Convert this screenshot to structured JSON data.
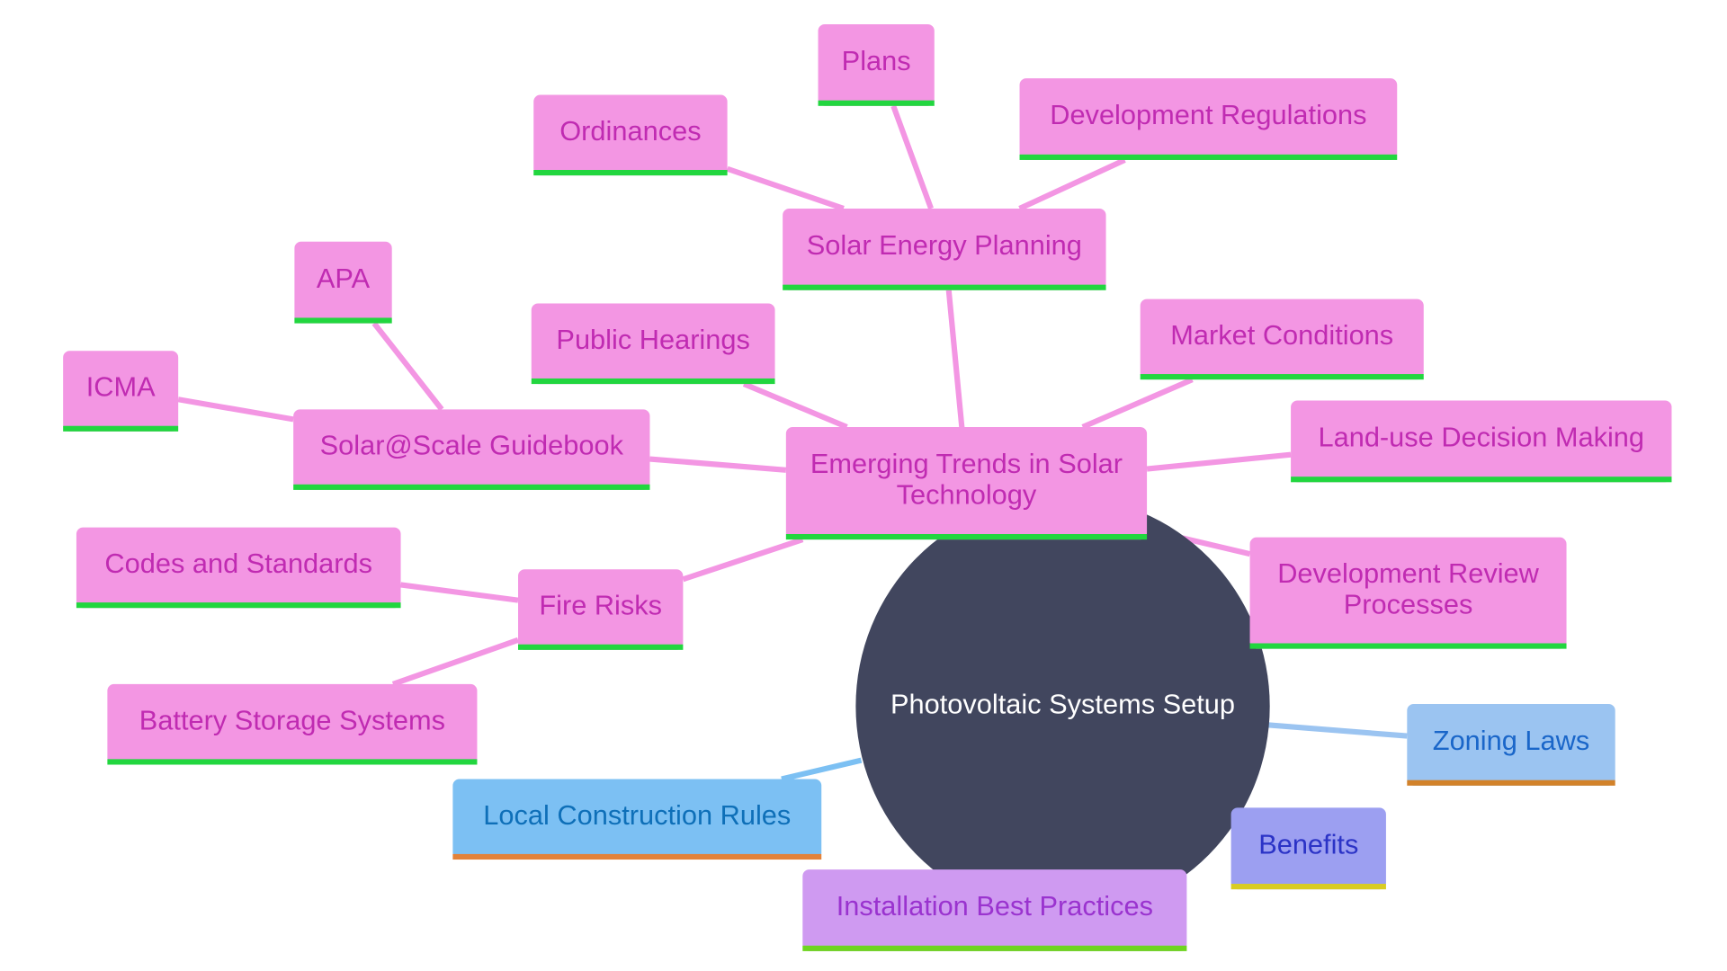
{
  "diagram": {
    "type": "mindmap",
    "root": {
      "label": "Photovoltaic Systems Setup"
    },
    "nodes": [
      {
        "id": "emerging",
        "label": [
          "Emerging Trends in Solar",
          "Technology"
        ],
        "parent": "root",
        "style": "pink"
      },
      {
        "id": "solar-planning",
        "label": [
          "Solar Energy Planning"
        ],
        "parent": "emerging",
        "style": "pink"
      },
      {
        "id": "ordinances",
        "label": [
          "Ordinances"
        ],
        "parent": "solar-planning",
        "style": "pink"
      },
      {
        "id": "plans",
        "label": [
          "Plans"
        ],
        "parent": "solar-planning",
        "style": "pink"
      },
      {
        "id": "dev-regs",
        "label": [
          "Development Regulations"
        ],
        "parent": "solar-planning",
        "style": "pink"
      },
      {
        "id": "public-hearings",
        "label": [
          "Public Hearings"
        ],
        "parent": "emerging",
        "style": "pink"
      },
      {
        "id": "market",
        "label": [
          "Market Conditions"
        ],
        "parent": "emerging",
        "style": "pink"
      },
      {
        "id": "land-use",
        "label": [
          "Land-use Decision Making"
        ],
        "parent": "emerging",
        "style": "pink"
      },
      {
        "id": "guidebook",
        "label": [
          "Solar@Scale Guidebook"
        ],
        "parent": "emerging",
        "style": "pink"
      },
      {
        "id": "apa",
        "label": [
          "APA"
        ],
        "parent": "guidebook",
        "style": "pink"
      },
      {
        "id": "icma",
        "label": [
          "ICMA"
        ],
        "parent": "guidebook",
        "style": "pink"
      },
      {
        "id": "fire",
        "label": [
          "Fire Risks"
        ],
        "parent": "emerging",
        "style": "pink"
      },
      {
        "id": "codes",
        "label": [
          "Codes and Standards"
        ],
        "parent": "fire",
        "style": "pink"
      },
      {
        "id": "battery",
        "label": [
          "Battery Storage Systems"
        ],
        "parent": "fire",
        "style": "pink"
      },
      {
        "id": "dev-review",
        "label": [
          "Development Review",
          "Processes"
        ],
        "parent": "emerging",
        "style": "pink"
      },
      {
        "id": "zoning",
        "label": [
          "Zoning Laws"
        ],
        "parent": "root",
        "style": "lightblue"
      },
      {
        "id": "local-rules",
        "label": [
          "Local Construction Rules"
        ],
        "parent": "root",
        "style": "blue"
      },
      {
        "id": "benefits",
        "label": [
          "Benefits"
        ],
        "parent": "root",
        "style": "periwinkle"
      },
      {
        "id": "install",
        "label": [
          "Installation Best Practices"
        ],
        "parent": "root",
        "style": "purple"
      }
    ],
    "styles": {
      "root": {
        "fill": "#41465e",
        "text": "#ffffff"
      },
      "pink": {
        "fill": "#f396e3",
        "text": "#c02bb2",
        "underline": "#22d63f",
        "edge": "#f396e3"
      },
      "lightblue": {
        "fill": "#9bc4f1",
        "text": "#1a66c9",
        "underline": "#d2822a",
        "edge": "#9bc4f1"
      },
      "blue": {
        "fill": "#7cc0f3",
        "text": "#0e6fb8",
        "underline": "#e2823a",
        "edge": "#7cc0f3"
      },
      "periwinkle": {
        "fill": "#9c9ff1",
        "text": "#2b33c6",
        "underline": "#d9cc22",
        "edge": "#9c9ff1"
      },
      "purple": {
        "fill": "#cf9af1",
        "text": "#9a33cf",
        "underline": "#6ed420",
        "edge": "#cf9af1"
      }
    }
  }
}
